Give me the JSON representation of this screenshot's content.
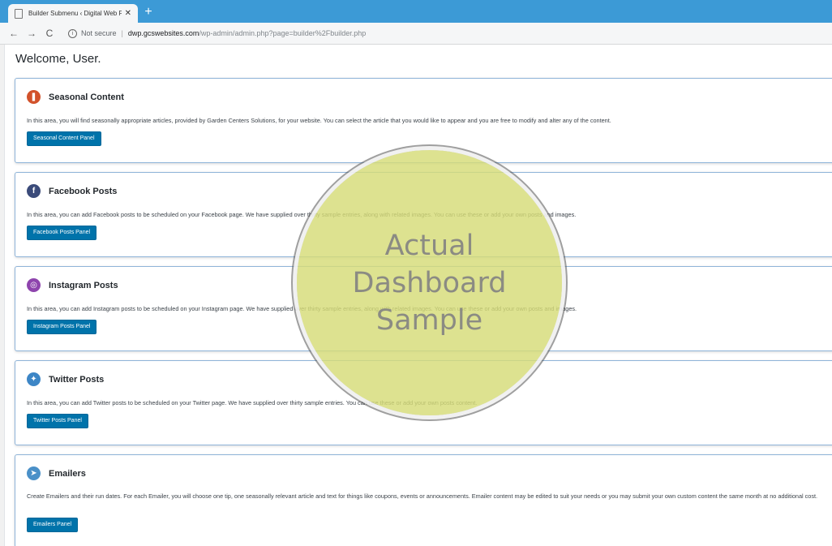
{
  "browser": {
    "tab_title": "Builder Submenu ‹ Digital Web F",
    "tab_close": "✕",
    "new_tab": "+",
    "back": "←",
    "forward": "→",
    "reload": "C",
    "info_glyph": "i",
    "security_label": "Not secure",
    "url_host": "dwp.gcswebsites.com",
    "url_path": "/wp-admin/admin.php?page=builder%2Fbuilder.php"
  },
  "page": {
    "welcome": "Welcome, User."
  },
  "panels": [
    {
      "icon": "book-icon",
      "icon_color": "#d2522b",
      "icon_glyph": "❚",
      "title": "Seasonal Content",
      "description": "In this area, you will find seasonally appropriate articles, provided by Garden Centers Solutions, for your website. You can select the article that you would like to appear and you are free to modify and alter any of the content.",
      "button": "Seasonal Content Panel"
    },
    {
      "icon": "facebook-icon",
      "icon_color": "#3b4b7a",
      "icon_glyph": "f",
      "title": "Facebook Posts",
      "description": "In this area, you can add Facebook posts to be scheduled on your Facebook page. We have supplied over thirty sample entries, along with related images. You can use these or add your own posts and images.",
      "button": "Facebook Posts Panel"
    },
    {
      "icon": "instagram-icon",
      "icon_color": "#8e44ad",
      "icon_glyph": "◎",
      "title": "Instagram Posts",
      "description": "In this area, you can add Instagram posts to be scheduled on your Instagram page. We have supplied over thirty sample entries, along with related images. You can use these or add your own posts and images.",
      "button": "Instagram Posts Panel"
    },
    {
      "icon": "twitter-icon",
      "icon_color": "#3d86c6",
      "icon_glyph": "✦",
      "title": "Twitter Posts",
      "description": "In this area, you can add Twitter posts to be scheduled on your Twitter page. We have supplied over thirty sample entries. You can use these or add your own posts content.",
      "button": "Twitter Posts Panel"
    },
    {
      "icon": "paper-plane-icon",
      "icon_color": "#4a90c8",
      "icon_glyph": "➤",
      "title": "Emailers",
      "description": "Create Emailers and their run dates. For each Emailer, you will choose one tip, one seasonally relevant article and text for things like coupons, events or announcements. Emailer content may be edited to suit your needs or you may submit your own custom content the same month at no additional cost.",
      "button": "Emailers Panel"
    }
  ],
  "overlay": {
    "line1": "Actual",
    "line2": "Dashboard",
    "line3": "Sample"
  },
  "colors": {
    "tab_strip": "#3c9ad6",
    "button": "#0073aa",
    "panel_border": "#8fb4d9",
    "overlay": "#d6dc78"
  }
}
